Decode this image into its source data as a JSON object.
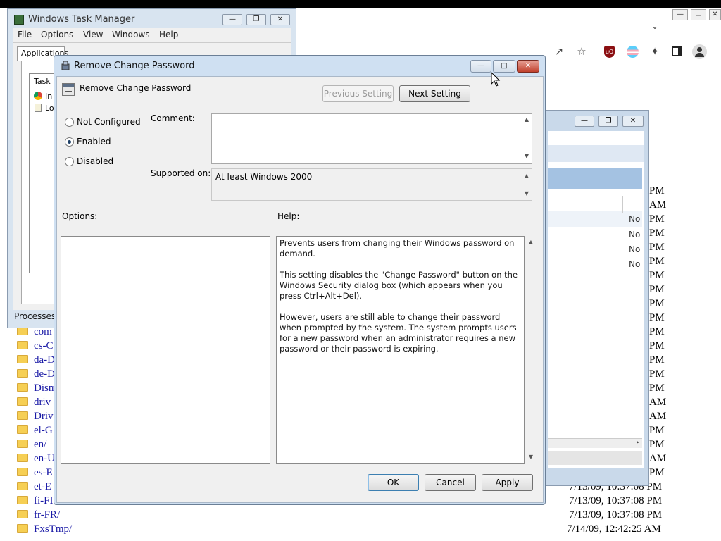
{
  "browser": {
    "toolbar_icons": [
      "share-icon",
      "star-icon",
      "ublock-icon",
      "pride-icon",
      "extensions-icon",
      "sidepanel-icon",
      "profile-icon"
    ]
  },
  "listing": {
    "rows": [
      {
        "name": "com",
        "date": ""
      },
      {
        "name": "cs-C",
        "date": ""
      },
      {
        "name": "da-D",
        "date": ""
      },
      {
        "name": "de-D",
        "date": ""
      },
      {
        "name": "Dism",
        "date": ""
      },
      {
        "name": "driv",
        "date": ""
      },
      {
        "name": "Driv",
        "date": ""
      },
      {
        "name": "el-G",
        "date": ""
      },
      {
        "name": "en/",
        "date": ""
      },
      {
        "name": "en-U",
        "date": ""
      },
      {
        "name": "es-E",
        "date": ""
      },
      {
        "name": "et-E",
        "date": "7/13/09, 10:37:08 PM"
      },
      {
        "name": "fi-FI",
        "date": "7/13/09, 10:37:08 PM"
      },
      {
        "name": "fr-FR/",
        "date": "7/13/09, 10:37:08 PM"
      },
      {
        "name": "FxsTmp/",
        "date": "7/14/09, 12:42:25 AM"
      }
    ],
    "ampm": [
      "PM",
      "AM",
      "PM",
      "PM",
      "PM",
      "PM",
      "PM",
      "PM",
      "PM",
      "PM",
      "PM",
      "PM",
      "PM",
      "PM",
      "AM",
      "AM",
      "PM",
      "PM",
      "AM"
    ],
    "right_partial": [
      "No",
      "No",
      "No",
      "No"
    ]
  },
  "taskmgr": {
    "title": "Windows Task Manager",
    "menu": [
      "File",
      "Options",
      "View",
      "Windows",
      "Help"
    ],
    "tabs": [
      "Applications"
    ],
    "column": "Task",
    "rows": [
      "In",
      "Lo"
    ],
    "status": "Processes"
  },
  "dialog": {
    "title": "Remove Change Password",
    "header_title": "Remove Change Password",
    "prev_button": "Previous Setting",
    "next_button": "Next Setting",
    "radios": [
      {
        "label": "Not Configured",
        "checked": false
      },
      {
        "label": "Enabled",
        "checked": true
      },
      {
        "label": "Disabled",
        "checked": false
      }
    ],
    "comment_label": "Comment:",
    "comment_value": "",
    "supported_label": "Supported on:",
    "supported_value": "At least Windows 2000",
    "options_label": "Options:",
    "help_label": "Help:",
    "help_paragraphs": [
      "Prevents users from changing their Windows password on demand.",
      "This setting disables the \"Change Password\" button on the Windows Security dialog box (which appears when you press Ctrl+Alt+Del).",
      "However, users are still able to change their password when prompted by the system. The system prompts users for a new password when an administrator requires a new password or their password is expiring."
    ],
    "ok_button": "OK",
    "cancel_button": "Cancel",
    "apply_button": "Apply"
  }
}
